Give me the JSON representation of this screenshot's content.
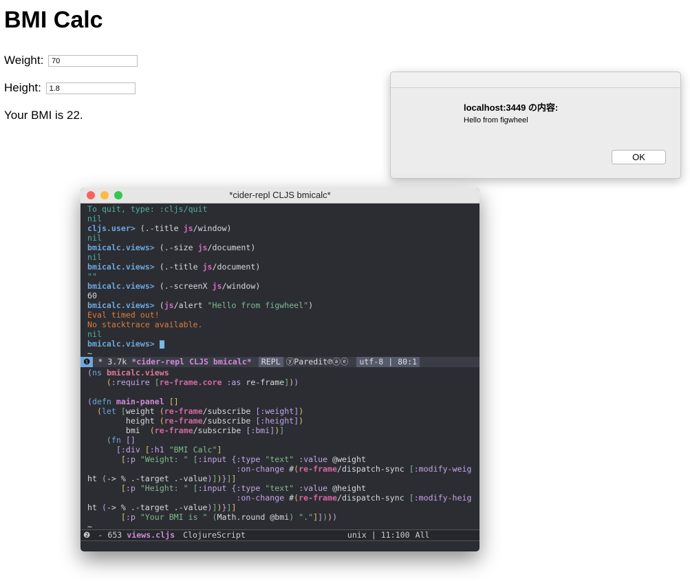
{
  "app": {
    "title": "BMI Calc",
    "weight_label": "Weight:",
    "weight_value": "70",
    "height_label": "Height:",
    "height_value": "1.8",
    "result_text": "Your BMI is 22."
  },
  "alert": {
    "title": "localhost:3449 の内容:",
    "message": "Hello from figwheel",
    "ok_label": "OK"
  },
  "terminal": {
    "title": "*cider-repl CLJS bmicalc*",
    "modeline1": {
      "window_num": "❶",
      "buffer_info": " * 3.7k ",
      "buffer_name": "*cider-repl CLJS bmicalc*",
      "mode": "REPL",
      "minor_modes": "ⓨParedit℗ⓐⓔ",
      "encoding": "utf-8 | 80:1"
    },
    "modeline2": {
      "window_num": "❷",
      "buffer_info": " - 653 ",
      "buffer_name": "views.cljs",
      "mode": "ClojureScript",
      "encoding": "unix | 11:100",
      "position": "All"
    }
  },
  "colors": {
    "terminal_bg": "#2b2d33",
    "prompt": "#6ea7dc",
    "error": "#e07b39",
    "string": "#7fb98a"
  }
}
